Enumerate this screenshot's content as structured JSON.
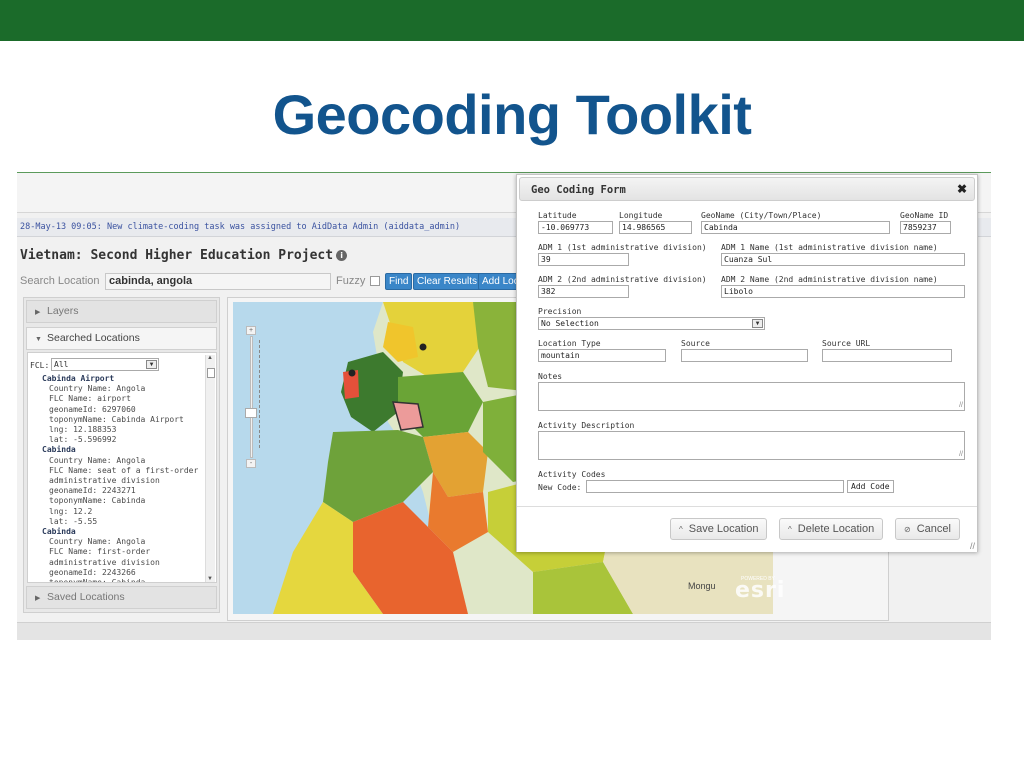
{
  "slide": {
    "title": "Geocoding Toolkit"
  },
  "colors": {
    "topbar": "#1b6b2a",
    "title": "#12548d",
    "button_blue": "#3a86c8"
  },
  "app": {
    "notification": "28-May-13 09:05: New climate-coding task was assigned to AidData Admin (aiddata_admin)",
    "project_title": "Vietnam: Second Higher Education Project",
    "info_icon": "info-icon",
    "search": {
      "label": "Search Location",
      "value": "cabinda, angola",
      "fuzzy_label": "Fuzzy",
      "find_label": "Find",
      "clear_label": "Clear Results",
      "add_label": "Add Location"
    },
    "panel": {
      "layers_label": "Layers",
      "searched_label": "Searched Locations",
      "saved_label": "Saved Locations",
      "fcl_label": "FCL:",
      "fcl_value": "All",
      "results": [
        {
          "name": "Cabinda Airport",
          "lines": [
            "Country Name: Angola",
            "FLC Name: airport",
            "geonameId: 6297060",
            "toponymName: Cabinda Airport",
            "lng: 12.188353",
            "lat: -5.596992"
          ]
        },
        {
          "name": "Cabinda",
          "lines": [
            "Country Name: Angola",
            "FLC Name: seat of a first-order",
            "administrative division",
            "geonameId: 2243271",
            "toponymName: Cabinda",
            "lng: 12.2",
            "lat: -5.55"
          ]
        },
        {
          "name": "Cabinda",
          "lines": [
            "Country Name: Angola",
            "FLC Name: first-order",
            "administrative division",
            "geonameId: 2243266",
            "toponymName: Cabinda"
          ]
        }
      ]
    },
    "map": {
      "place_label": "Mongu",
      "attribution": "esri",
      "powered_by": "POWERED BY"
    }
  },
  "dialog": {
    "title": "Geo Coding Form",
    "close_icon": "close-icon",
    "fields": {
      "latitude_label": "Latitude",
      "latitude_value": "-10.069773",
      "longitude_label": "Longitude",
      "longitude_value": "14.986565",
      "geoname_label": "GeoName (City/Town/Place)",
      "geoname_value": "Cabinda",
      "geoname_id_label": "GeoName ID",
      "geoname_id_value": "7859237",
      "adm1_label": "ADM 1 (1st administrative division)",
      "adm1_value": "39",
      "adm1_name_label": "ADM 1 Name (1st administrative division name)",
      "adm1_name_value": "Cuanza Sul",
      "adm2_label": "ADM 2 (2nd administrative division)",
      "adm2_value": "382",
      "adm2_name_label": "ADM 2 Name (2nd administrative division name)",
      "adm2_name_value": "Libolo",
      "precision_label": "Precision",
      "precision_value": "No Selection",
      "location_type_label": "Location Type",
      "location_type_value": "mountain",
      "source_label": "Source",
      "source_value": "",
      "source_url_label": "Source URL",
      "source_url_value": "",
      "notes_label": "Notes",
      "activity_description_label": "Activity Description",
      "activity_codes_label": "Activity Codes",
      "new_code_label": "New Code:",
      "add_code_label": "Add Code"
    },
    "buttons": {
      "save": "Save Location",
      "delete": "Delete Location",
      "cancel": "Cancel"
    }
  }
}
